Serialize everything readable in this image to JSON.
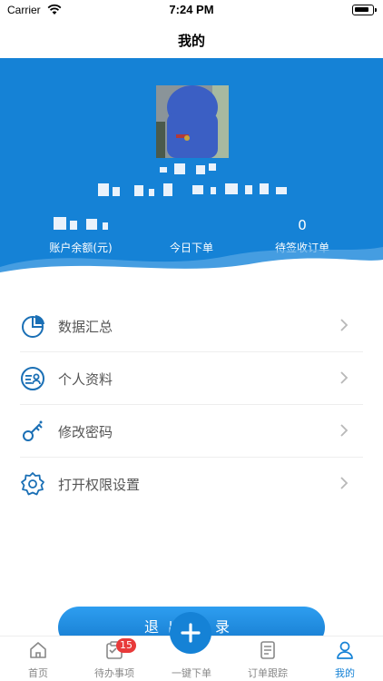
{
  "status_bar": {
    "carrier": "Carrier",
    "time": "7:24 PM"
  },
  "nav": {
    "title": "我的"
  },
  "profile": {
    "stats": [
      {
        "value": "",
        "label": "账户余额(元)"
      },
      {
        "value": "",
        "label": "今日下单"
      },
      {
        "value": "0",
        "label": "待签收订单"
      }
    ]
  },
  "menu": {
    "items": [
      {
        "label": "数据汇总",
        "icon": "pie-chart-icon"
      },
      {
        "label": "个人资料",
        "icon": "profile-card-icon"
      },
      {
        "label": "修改密码",
        "icon": "key-icon"
      },
      {
        "label": "打开权限设置",
        "icon": "gear-icon"
      }
    ]
  },
  "logout": {
    "label": "退出登录"
  },
  "tabs": [
    {
      "label": "首页",
      "icon": "home-icon"
    },
    {
      "label": "待办事项",
      "icon": "todo-icon",
      "badge": "15"
    },
    {
      "label": "一键下单",
      "icon": "plus-icon"
    },
    {
      "label": "订单跟踪",
      "icon": "document-icon"
    },
    {
      "label": "我的",
      "icon": "user-icon"
    }
  ],
  "colors": {
    "primary": "#1582d6",
    "badge": "#e83a3a",
    "icon": "#1a6fb5"
  }
}
